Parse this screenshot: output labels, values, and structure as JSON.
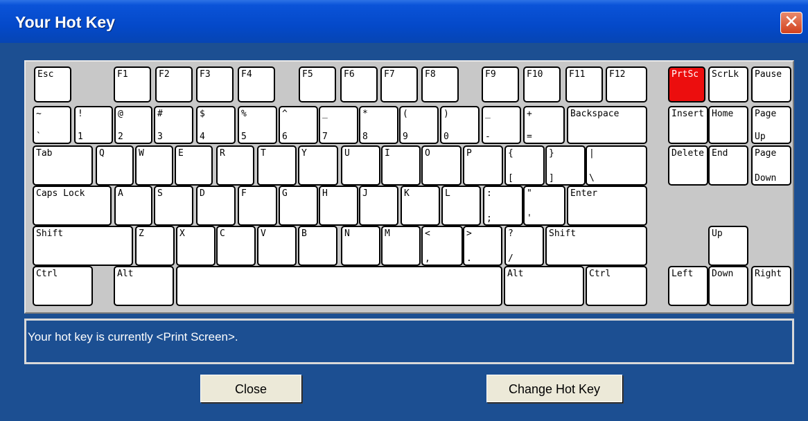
{
  "window": {
    "title": "Your Hot Key",
    "close_glyph": "✕"
  },
  "keyboard": {
    "selected_key": "PrtSc",
    "keys": [
      {
        "top": "Esc",
        "bottom": ""
      },
      {
        "top": "F1",
        "bottom": ""
      },
      {
        "top": "F2",
        "bottom": ""
      },
      {
        "top": "F3",
        "bottom": ""
      },
      {
        "top": "F4",
        "bottom": ""
      },
      {
        "top": "F5",
        "bottom": ""
      },
      {
        "top": "F6",
        "bottom": ""
      },
      {
        "top": "F7",
        "bottom": ""
      },
      {
        "top": "F8",
        "bottom": ""
      },
      {
        "top": "F9",
        "bottom": ""
      },
      {
        "top": "F10",
        "bottom": ""
      },
      {
        "top": "F11",
        "bottom": ""
      },
      {
        "top": "F12",
        "bottom": ""
      },
      {
        "top": "PrtSc",
        "bottom": ""
      },
      {
        "top": "ScrLk",
        "bottom": ""
      },
      {
        "top": "Pause",
        "bottom": ""
      },
      {
        "top": "~",
        "bottom": "`"
      },
      {
        "top": "!",
        "bottom": "1"
      },
      {
        "top": "@",
        "bottom": "2"
      },
      {
        "top": "#",
        "bottom": "3"
      },
      {
        "top": "$",
        "bottom": "4"
      },
      {
        "top": "%",
        "bottom": "5"
      },
      {
        "top": "^",
        "bottom": "6"
      },
      {
        "top": "_",
        "bottom": "7"
      },
      {
        "top": "*",
        "bottom": "8"
      },
      {
        "top": "(",
        "bottom": "9"
      },
      {
        "top": ")",
        "bottom": "0"
      },
      {
        "top": "_",
        "bottom": "-"
      },
      {
        "top": "+",
        "bottom": "="
      },
      {
        "top": "Backspace",
        "bottom": ""
      },
      {
        "top": "Insert",
        "bottom": ""
      },
      {
        "top": "Home",
        "bottom": ""
      },
      {
        "top": "Page",
        "bottom": "Up"
      },
      {
        "top": "Tab",
        "bottom": ""
      },
      {
        "top": "Q",
        "bottom": ""
      },
      {
        "top": "W",
        "bottom": ""
      },
      {
        "top": "E",
        "bottom": ""
      },
      {
        "top": "R",
        "bottom": ""
      },
      {
        "top": "T",
        "bottom": ""
      },
      {
        "top": "Y",
        "bottom": ""
      },
      {
        "top": "U",
        "bottom": ""
      },
      {
        "top": "I",
        "bottom": ""
      },
      {
        "top": "O",
        "bottom": ""
      },
      {
        "top": "P",
        "bottom": ""
      },
      {
        "top": "{",
        "bottom": "["
      },
      {
        "top": "}",
        "bottom": "]"
      },
      {
        "top": "|",
        "bottom": "\\"
      },
      {
        "top": "Delete",
        "bottom": ""
      },
      {
        "top": "End",
        "bottom": ""
      },
      {
        "top": "Page",
        "bottom": "Down"
      },
      {
        "top": "Caps Lock",
        "bottom": ""
      },
      {
        "top": "A",
        "bottom": ""
      },
      {
        "top": "S",
        "bottom": ""
      },
      {
        "top": "D",
        "bottom": ""
      },
      {
        "top": "F",
        "bottom": ""
      },
      {
        "top": "G",
        "bottom": ""
      },
      {
        "top": "H",
        "bottom": ""
      },
      {
        "top": "J",
        "bottom": ""
      },
      {
        "top": "K",
        "bottom": ""
      },
      {
        "top": "L",
        "bottom": ""
      },
      {
        "top": ":",
        "bottom": ";"
      },
      {
        "top": "\"",
        "bottom": "'"
      },
      {
        "top": "Enter",
        "bottom": ""
      },
      {
        "top": "Shift",
        "bottom": ""
      },
      {
        "top": "Z",
        "bottom": ""
      },
      {
        "top": "X",
        "bottom": ""
      },
      {
        "top": "C",
        "bottom": ""
      },
      {
        "top": "V",
        "bottom": ""
      },
      {
        "top": "B",
        "bottom": ""
      },
      {
        "top": "N",
        "bottom": ""
      },
      {
        "top": "M",
        "bottom": ""
      },
      {
        "top": "<",
        "bottom": ","
      },
      {
        "top": ">",
        "bottom": "."
      },
      {
        "top": "?",
        "bottom": "/"
      },
      {
        "top": "Shift",
        "bottom": ""
      },
      {
        "top": "Up",
        "bottom": ""
      },
      {
        "top": "Ctrl",
        "bottom": ""
      },
      {
        "top": "Alt",
        "bottom": ""
      },
      {
        "top": "",
        "bottom": ""
      },
      {
        "top": "Alt",
        "bottom": ""
      },
      {
        "top": "Ctrl",
        "bottom": ""
      },
      {
        "top": "Left",
        "bottom": ""
      },
      {
        "top": "Down",
        "bottom": ""
      },
      {
        "top": "Right",
        "bottom": ""
      }
    ]
  },
  "status": {
    "text": "Your hot key is currently <Print Screen>."
  },
  "buttons": {
    "close": "Close",
    "change": "Change Hot Key"
  },
  "colors": {
    "window_bg": "#1c4f92",
    "selected_key": "#ec0e0e",
    "titlebar": "#0449c9"
  }
}
